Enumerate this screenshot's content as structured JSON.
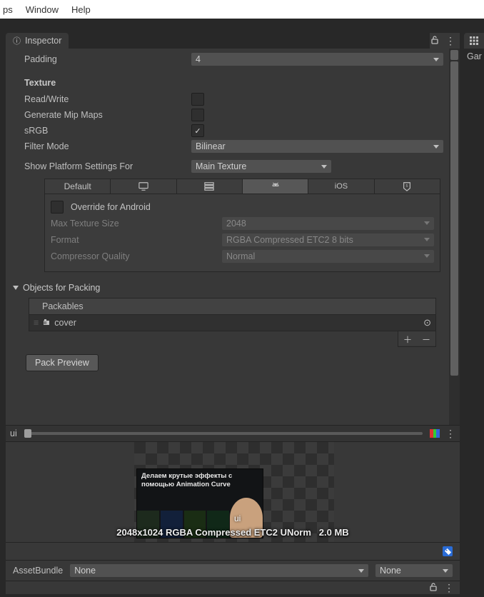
{
  "menu": {
    "items": [
      "ps",
      "Window",
      "Help"
    ]
  },
  "inspector": {
    "title": "Inspector"
  },
  "right_panel": {
    "label": "Gar"
  },
  "padding": {
    "label": "Padding",
    "value": "4"
  },
  "texture": {
    "heading": "Texture",
    "read_write": {
      "label": "Read/Write",
      "checked": false
    },
    "mipmaps": {
      "label": "Generate Mip Maps",
      "checked": false
    },
    "srgb": {
      "label": "sRGB",
      "checked": true
    },
    "filter_mode": {
      "label": "Filter Mode",
      "value": "Bilinear"
    }
  },
  "platform": {
    "label": "Show Platform Settings For",
    "value": "Main Texture",
    "tabs": {
      "default": "Default"
    },
    "override": {
      "label": "Override for Android",
      "checked": false
    },
    "max_size": {
      "label": "Max Texture Size",
      "value": "2048"
    },
    "format": {
      "label": "Format",
      "value": "RGBA Compressed ETC2 8 bits"
    },
    "quality": {
      "label": "Compressor Quality",
      "value": "Normal"
    }
  },
  "packing": {
    "heading": "Objects for Packing",
    "packables": "Packables",
    "item_icon": "trash-icon",
    "item": "cover",
    "button": "Pack Preview"
  },
  "preview": {
    "name": "ui",
    "thumb_caption": "Делаем крутые эффекты с помощью Animation Curve",
    "thumb_tag": "ui",
    "info_res": "2048x1024 RGBA Compressed ETC2 UNorm",
    "info_size": "2.0 MB"
  },
  "assetbundle": {
    "label": "AssetBundle",
    "value": "None",
    "variant": "None"
  }
}
